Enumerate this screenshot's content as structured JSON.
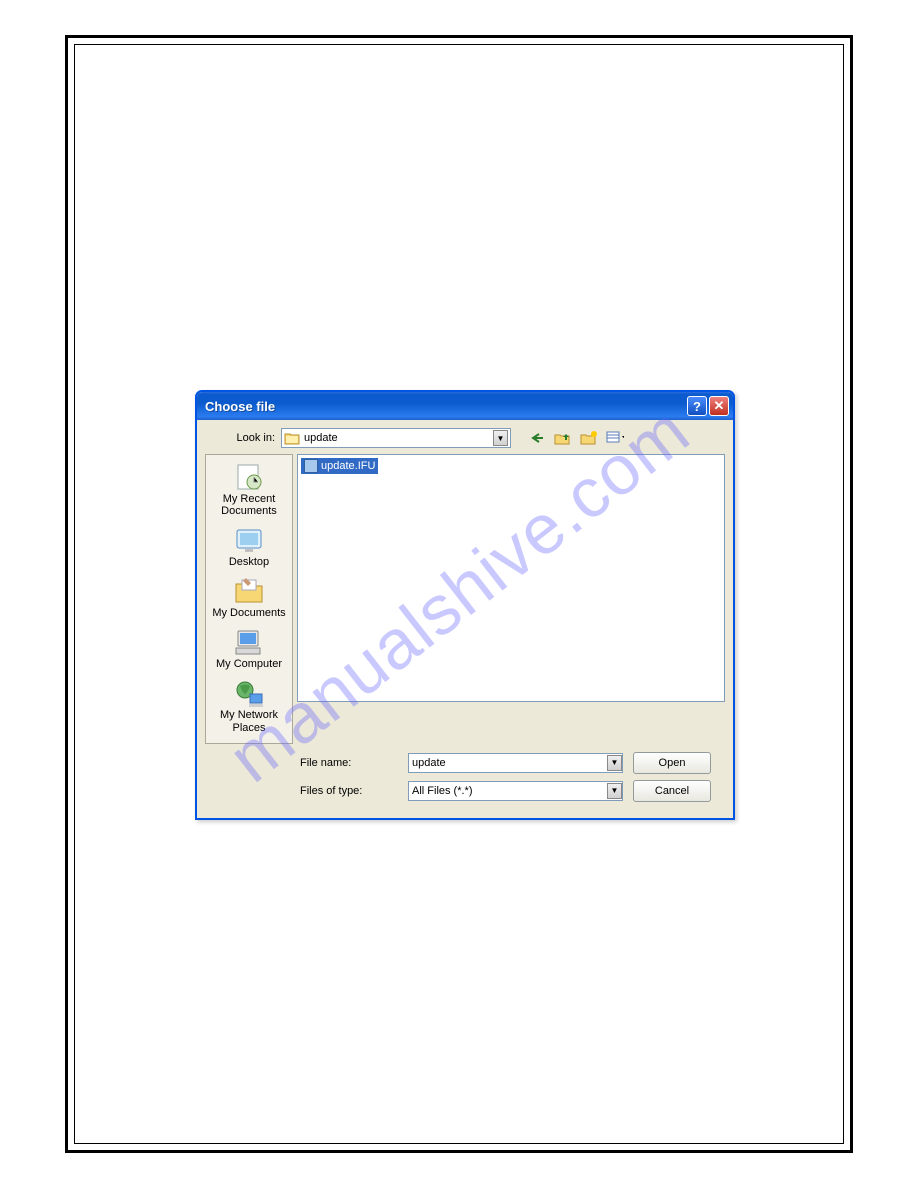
{
  "watermark": "manualshive.com",
  "dialog": {
    "title": "Choose file",
    "lookin_label": "Look in:",
    "lookin_value": "update",
    "places": [
      {
        "label": "My Recent Documents"
      },
      {
        "label": "Desktop"
      },
      {
        "label": "My Documents"
      },
      {
        "label": "My Computer"
      },
      {
        "label": "My Network Places"
      }
    ],
    "file_item": "update.IFU",
    "filename_label": "File name:",
    "filename_value": "update",
    "filetype_label": "Files of type:",
    "filetype_value": "All Files (*.*)",
    "open_label": "Open",
    "cancel_label": "Cancel"
  }
}
